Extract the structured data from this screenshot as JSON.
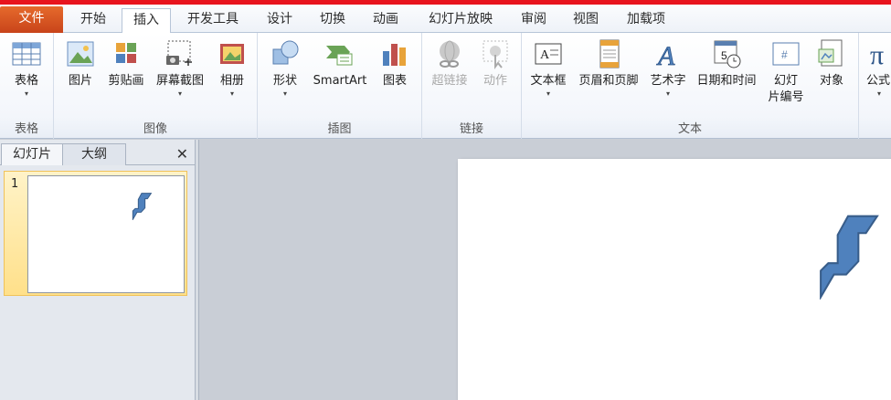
{
  "tabs": [
    "文件",
    "开始",
    "插入",
    "开发工具",
    "设计",
    "切换",
    "动画",
    "幻灯片放映",
    "审阅",
    "视图",
    "加载项"
  ],
  "active_tab": "插入",
  "groups": {
    "tables": {
      "label": "表格",
      "buttons": {
        "table": "表格"
      }
    },
    "images": {
      "label": "图像",
      "buttons": {
        "picture": "图片",
        "clipart": "剪贴画",
        "screenshot": "屏幕截图",
        "album": "相册"
      }
    },
    "illustrations": {
      "label": "插图",
      "buttons": {
        "shapes": "形状",
        "smartart": "SmartArt",
        "chart": "图表"
      }
    },
    "links": {
      "label": "链接",
      "buttons": {
        "hyperlink": "超链接",
        "action": "动作"
      }
    },
    "text": {
      "label": "文本",
      "buttons": {
        "textbox": "文本框",
        "headerfooter": "页眉和页脚",
        "wordart": "艺术字",
        "datetime": "日期和时间",
        "slidenum_line1": "幻灯",
        "slidenum_line2": "片编号",
        "object": "对象"
      }
    },
    "symbols": {
      "buttons": {
        "equation": "公式"
      }
    }
  },
  "panel": {
    "tab_slides": "幻灯片",
    "tab_outline": "大纲",
    "close": "✕",
    "slide_number": "1"
  },
  "colors": {
    "accent_file": "#d2501f",
    "shape_fill": "#4f81bd",
    "shape_stroke": "#385d8a",
    "thumb_highlight": "#ffe08a"
  }
}
